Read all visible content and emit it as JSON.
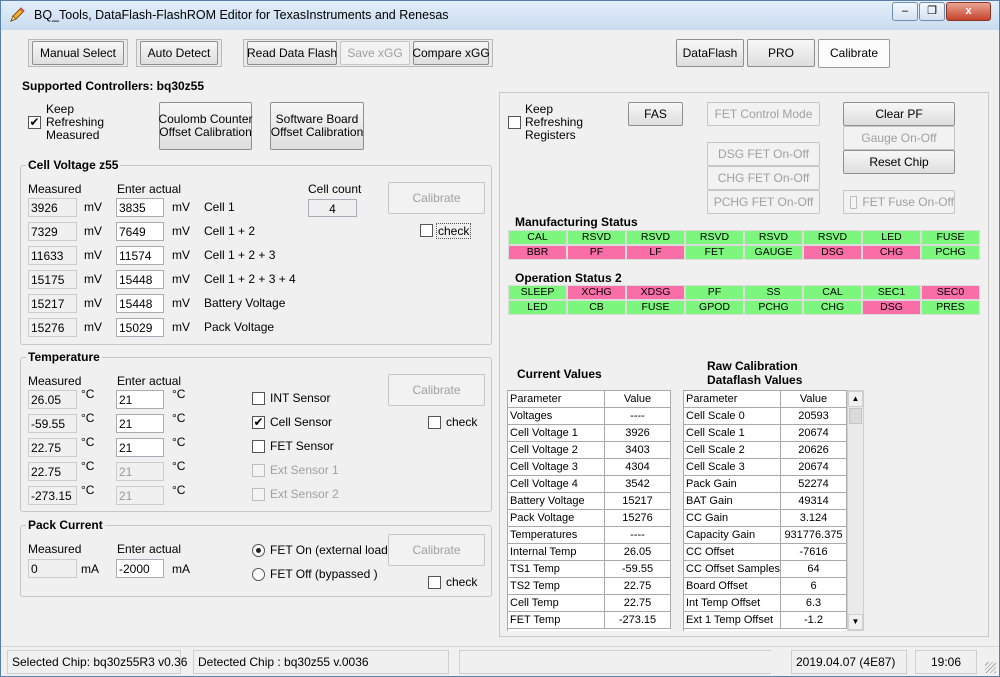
{
  "window": {
    "title": "BQ_Tools,   DataFlash-FlashROM Editor    for TexasInstruments and Renesas",
    "min_glyph": "–",
    "restore_glyph": "❐",
    "close_glyph": "x"
  },
  "toolbar": {
    "manual_select": "Manual Select",
    "auto_detect": "Auto Detect",
    "read_data_flash": "Read Data Flash",
    "save_xgg": "Save xGG",
    "compare_xgg": "Compare xGG",
    "dataflash_tab": "DataFlash",
    "pro_tab": "PRO",
    "calibrate_tab": "Calibrate"
  },
  "left": {
    "supported": "Supported Controllers: bq30z55",
    "keep_refreshing": [
      "Keep",
      "Refreshing",
      "Measured"
    ],
    "keep_refreshing_check": "✔",
    "coulomb_btn": [
      "Coulomb Counter",
      "Offset Calibration"
    ],
    "software_btn": [
      "Software Board",
      "Offset Calibration"
    ]
  },
  "cell_voltage": {
    "title": "Cell Voltage z55",
    "measured_hdr": "Measured",
    "enter_hdr": "Enter actual",
    "cell_count_label": "Cell count",
    "cell_count": "4",
    "calibrate": "Calibrate",
    "check": "check",
    "rows": [
      {
        "measured": "3926",
        "unit": "mV",
        "actual": "3835",
        "unit2": "mV",
        "label": "Cell 1"
      },
      {
        "measured": "7329",
        "unit": "mV",
        "actual": "7649",
        "unit2": "mV",
        "label": "Cell 1 + 2"
      },
      {
        "measured": "11633",
        "unit": "mV",
        "actual": "11574",
        "unit2": "mV",
        "label": "Cell 1 + 2 + 3"
      },
      {
        "measured": "15175",
        "unit": "mV",
        "actual": "15448",
        "unit2": "mV",
        "label": "Cell 1 + 2 + 3 + 4"
      },
      {
        "measured": "15217",
        "unit": "mV",
        "actual": "15448",
        "unit2": "mV",
        "label": "Battery  Voltage"
      },
      {
        "measured": "15276",
        "unit": "mV",
        "actual": "15029",
        "unit2": "mV",
        "label": "Pack    Voltage"
      }
    ]
  },
  "temperature": {
    "title": "Temperature",
    "measured_hdr": "Measured",
    "enter_hdr": "Enter actual",
    "calibrate": "Calibrate",
    "check": "check",
    "rows": [
      {
        "measured": "26.05",
        "unit": "°C",
        "actual": "21",
        "unit2": "°C"
      },
      {
        "measured": "-59.55",
        "unit": "°C",
        "actual": "21",
        "unit2": "°C"
      },
      {
        "measured": "22.75",
        "unit": "°C",
        "actual": "21",
        "unit2": "°C"
      },
      {
        "measured": "22.75",
        "unit": "°C",
        "actual": "21",
        "unit2": "°C"
      },
      {
        "measured": "-273.15",
        "unit": "°C",
        "actual": "21",
        "unit2": "°C"
      }
    ],
    "sensors": [
      {
        "label": "INT Sensor",
        "mark": ""
      },
      {
        "label": "Cell Sensor",
        "mark": "✔"
      },
      {
        "label": "FET Sensor",
        "mark": ""
      },
      {
        "label": "Ext Sensor 1",
        "mark": ""
      },
      {
        "label": "Ext Sensor 2",
        "mark": ""
      }
    ]
  },
  "pack_current": {
    "title": "Pack Current",
    "measured_hdr": "Measured",
    "enter_hdr": "Enter actual",
    "measured": "0",
    "unit": "mA",
    "actual": "-2000",
    "unit2": "mA",
    "fet_on": "FET On (external load)",
    "fet_off": "FET Off (bypassed      )",
    "calibrate": "Calibrate",
    "check": "check"
  },
  "right": {
    "keep_refreshing": [
      "Keep",
      "Refreshing",
      "Registers"
    ],
    "fas": "FAS",
    "fet_control_mode": "FET Control Mode",
    "dsg": "DSG   FET  On-Off",
    "chg": "CHG   FET  On-Off",
    "pchg": "PCHG  FET  On-Off",
    "clear_pf": "Clear PF",
    "gauge_on_off": "Gauge On-Off",
    "reset_chip": "Reset Chip",
    "fet_fuse": "FET Fuse On-Off"
  },
  "manufacturing_status": {
    "title": "Manufacturing Status",
    "row1": [
      {
        "t": "CAL",
        "s": "g"
      },
      {
        "t": "RSVD",
        "s": "g"
      },
      {
        "t": "RSVD",
        "s": "g"
      },
      {
        "t": "RSVD",
        "s": "g"
      },
      {
        "t": "RSVD",
        "s": "g"
      },
      {
        "t": "RSVD",
        "s": "g"
      },
      {
        "t": "LED",
        "s": "g"
      },
      {
        "t": "FUSE",
        "s": "g"
      }
    ],
    "row2": [
      {
        "t": "BBR",
        "s": "p"
      },
      {
        "t": "PF",
        "s": "p"
      },
      {
        "t": "LF",
        "s": "p"
      },
      {
        "t": "FET",
        "s": "g"
      },
      {
        "t": "GAUGE",
        "s": "g"
      },
      {
        "t": "DSG",
        "s": "p"
      },
      {
        "t": "CHG",
        "s": "p"
      },
      {
        "t": "PCHG",
        "s": "g"
      }
    ]
  },
  "operation_status": {
    "title": "Operation Status 2",
    "row1": [
      {
        "t": "SLEEP",
        "s": "g"
      },
      {
        "t": "XCHG",
        "s": "p"
      },
      {
        "t": "XDSG",
        "s": "p"
      },
      {
        "t": "PF",
        "s": "g"
      },
      {
        "t": "SS",
        "s": "g"
      },
      {
        "t": "CAL",
        "s": "g"
      },
      {
        "t": "SEC1",
        "s": "g"
      },
      {
        "t": "SEC0",
        "s": "p"
      }
    ],
    "row2": [
      {
        "t": "LED",
        "s": "g"
      },
      {
        "t": "CB",
        "s": "g"
      },
      {
        "t": "FUSE",
        "s": "g"
      },
      {
        "t": "GPOD",
        "s": "g"
      },
      {
        "t": "PCHG",
        "s": "g"
      },
      {
        "t": "CHG",
        "s": "g"
      },
      {
        "t": "DSG",
        "s": "p"
      },
      {
        "t": "PRES",
        "s": "g"
      }
    ]
  },
  "current_values": {
    "title": "Current Values",
    "header": [
      "Parameter",
      "Value"
    ],
    "rows": [
      [
        "Voltages",
        "----"
      ],
      [
        "Cell Voltage 1",
        "3926"
      ],
      [
        "Cell Voltage 2",
        "3403"
      ],
      [
        "Cell Voltage 3",
        "4304"
      ],
      [
        "Cell Voltage 4",
        "3542"
      ],
      [
        "Battery Voltage",
        "15217"
      ],
      [
        "Pack Voltage",
        "15276"
      ],
      [
        "Temperatures",
        "----"
      ],
      [
        "Internal Temp",
        "26.05"
      ],
      [
        "TS1 Temp",
        "-59.55"
      ],
      [
        "TS2 Temp",
        "22.75"
      ],
      [
        "Cell Temp",
        "22.75"
      ],
      [
        "FET Temp",
        "-273.15"
      ]
    ]
  },
  "raw_calibration": {
    "title1": "Raw    Calibration",
    "title2": "Dataflash  Values",
    "header": [
      "Parameter",
      "Value"
    ],
    "rows": [
      [
        "Cell Scale 0",
        "20593"
      ],
      [
        "Cell Scale 1",
        "20674"
      ],
      [
        "Cell Scale 2",
        "20626"
      ],
      [
        "Cell Scale 3",
        "20674"
      ],
      [
        "Pack Gain",
        "52274"
      ],
      [
        "BAT Gain",
        "49314"
      ],
      [
        "CC Gain",
        "3.124"
      ],
      [
        "Capacity Gain",
        "931776.375"
      ],
      [
        "CC Offset",
        "-7616"
      ],
      [
        "CC Offset Samples",
        "64"
      ],
      [
        "Board Offset",
        "6"
      ],
      [
        "Int Temp Offset",
        "6.3"
      ],
      [
        "Ext 1 Temp Offset",
        "-1.2"
      ]
    ],
    "scroll_up": "▲",
    "scroll_down": "▼"
  },
  "statusbar": {
    "selected_chip": "Selected Chip:  bq30z55R3 v0.36",
    "detected_chip": "Detected Chip :  bq30z55  v.0036",
    "date": "2019.04.07  (4E87)",
    "time": "19:06"
  }
}
